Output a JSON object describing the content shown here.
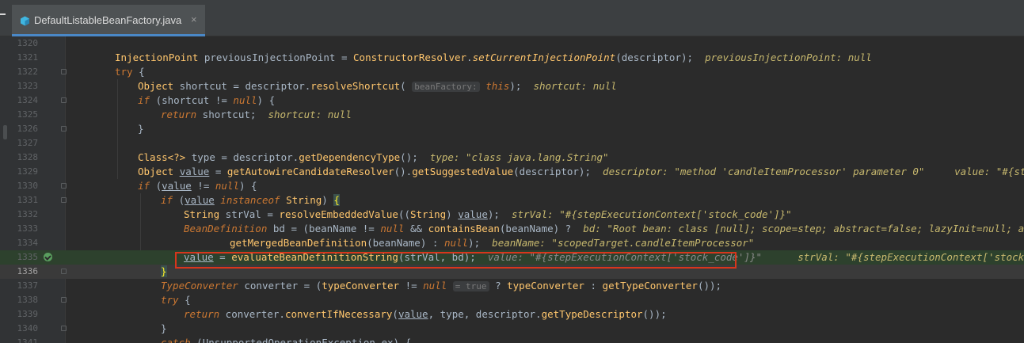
{
  "tab": {
    "file_name": "DefaultListableBeanFactory.java",
    "close_label": "×",
    "icon": "java-class-icon",
    "accent": "#4a88c7"
  },
  "editor": {
    "current_line": "1336",
    "execution_line": "1335",
    "highlight_color": "#d7361c",
    "lines": [
      {
        "n": "1320"
      },
      {
        "n": "1321"
      },
      {
        "n": "1322"
      },
      {
        "n": "1323"
      },
      {
        "n": "1324"
      },
      {
        "n": "1325"
      },
      {
        "n": "1326"
      },
      {
        "n": "1327"
      },
      {
        "n": "1328"
      },
      {
        "n": "1329"
      },
      {
        "n": "1330"
      },
      {
        "n": "1331"
      },
      {
        "n": "1332"
      },
      {
        "n": "1333"
      },
      {
        "n": "1334"
      },
      {
        "n": "1335"
      },
      {
        "n": "1336"
      },
      {
        "n": "1337"
      },
      {
        "n": "1338"
      },
      {
        "n": "1339"
      },
      {
        "n": "1340"
      },
      {
        "n": "1341"
      }
    ]
  },
  "code": {
    "l1321": {
      "t1": "InjectionPoint",
      "t2": " previousInjectionPoint = ",
      "t3": "ConstructorResolver",
      "t4": ".",
      "t5": "setCurrentInjectionPoint",
      "t6": "(descriptor);",
      "inline": "previousInjectionPoint: null"
    },
    "l1322": {
      "kw": "try",
      "rest": " {"
    },
    "l1323": {
      "t1": "Object",
      "t2": " shortcut = descriptor.",
      "t3": "resolveShortcut",
      "t4": "(",
      "hint": "beanFactory:",
      "t5": "this",
      "t6": ");",
      "inline": "shortcut: null"
    },
    "l1324": {
      "kw": "if",
      "t2": " (shortcut != ",
      "t3": "null",
      "t4": ") {"
    },
    "l1325": {
      "kw": "return",
      "t2": " shortcut;",
      "inline": "shortcut: null"
    },
    "l1326": {
      "t": "}"
    },
    "l1328": {
      "t1": "Class<?>",
      "t2": " type = descriptor.",
      "t3": "getDependencyType",
      "t4": "();",
      "inline": "type: \"class java.lang.String\""
    },
    "l1329": {
      "t1": "Object",
      "t2": " ",
      "t3": "value",
      "t4": " = ",
      "t5": "getAutowireCandidateResolver",
      "t6": "().",
      "t7": "getSuggestedValue",
      "t8": "(descriptor);",
      "inline1": "descriptor: \"method 'candleItemProcessor' parameter 0\"",
      "inline2": "value: \"#{stepExecu"
    },
    "l1330": {
      "kw": "if",
      "t2": " (",
      "t3": "value",
      "t4": " != ",
      "t5": "null",
      "t6": ") {"
    },
    "l1331": {
      "kw": "if",
      "t2": " (",
      "t3": "value",
      "t4": " ",
      "t5": "instanceof",
      "t6": " ",
      "t7": "String",
      "t8": ") ",
      "t9": "{"
    },
    "l1332": {
      "t1": "String",
      "t2": " strVal = ",
      "t3": "resolveEmbeddedValue",
      "t4": "((",
      "t5": "String",
      "t6": ") ",
      "t7": "value",
      "t8": ");",
      "inline": "strVal: \"#{stepExecutionContext['stock_code']}\""
    },
    "l1333": {
      "t1": "BeanDefinition",
      "t2": " bd = (beanName != ",
      "t3": "null",
      "t4": " && ",
      "t5": "containsBean",
      "t6": "(beanName) ?",
      "inline": "bd: \"Root bean: class [null]; scope=step; abstract=false; lazyInit=null; autowire"
    },
    "l1334": {
      "t1": "getMergedBeanDefinition",
      "t2": "(beanName) : ",
      "t3": "null",
      "t4": ");",
      "inline": "beanName: \"scopedTarget.candleItemProcessor\""
    },
    "l1335": {
      "t1": "value",
      "t2": " = ",
      "t3": "evaluateBeanDefinitionString",
      "t4": "(strVal, bd);",
      "inline1": "value: \"#{stepExecutionContext['stock_code']}\"",
      "inline2": "strVal: \"#{stepExecutionContext['stock_code']}\""
    },
    "l1336": {
      "t": "}"
    },
    "l1337": {
      "t1": "TypeConverter",
      "t2": " converter = (",
      "t3": "typeConverter",
      "t4": " != ",
      "t5": "null",
      "hint": "= true",
      "t6": " ? ",
      "t7": "typeConverter",
      "t8": " : ",
      "t9": "getTypeConverter",
      "t10": "());"
    },
    "l1338": {
      "kw": "try",
      "rest": " {"
    },
    "l1339": {
      "kw": "return",
      "t2": " converter.",
      "t3": "convertIfNecessary",
      "t4": "(",
      "t5": "value",
      "t6": ", type, descriptor.",
      "t7": "getTypeDescriptor",
      "t8": "());"
    },
    "l1340": {
      "t": "}"
    },
    "l1341": {
      "kw": "catch",
      "rest": " (UnsupportedOperationException ex) {"
    }
  }
}
